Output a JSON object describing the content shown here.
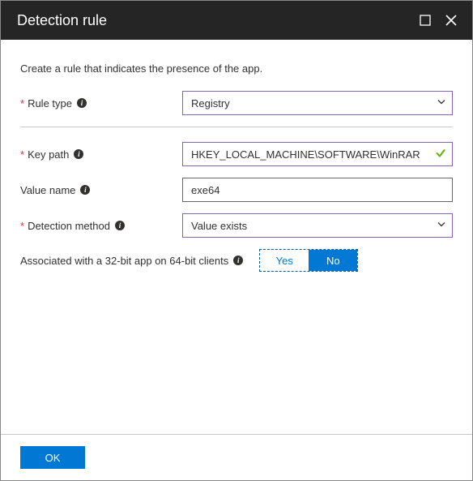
{
  "title": "Detection rule",
  "description": "Create a rule that indicates the presence of the app.",
  "fields": {
    "ruleType": {
      "label": "Rule type",
      "value": "Registry",
      "required": true
    },
    "keyPath": {
      "label": "Key path",
      "value": "HKEY_LOCAL_MACHINE\\SOFTWARE\\WinRAR",
      "required": true
    },
    "valueName": {
      "label": "Value name",
      "value": "exe64",
      "required": false
    },
    "detectionMethod": {
      "label": "Detection method",
      "value": "Value exists",
      "required": true
    },
    "assoc32": {
      "label": "Associated with a 32-bit app on 64-bit clients",
      "yes": "Yes",
      "no": "No",
      "selected": "No"
    }
  },
  "buttons": {
    "ok": "OK"
  }
}
